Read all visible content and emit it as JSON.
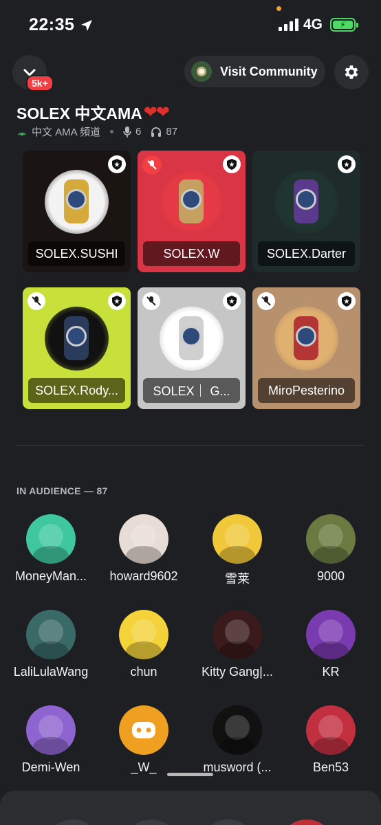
{
  "status": {
    "time": "22:35",
    "network": "4G"
  },
  "header": {
    "badge": "5k+",
    "visit_label": "Visit Community"
  },
  "stage": {
    "title": "SOLEX 中文AMA",
    "channel": "中文 AMA 頻道",
    "speakers_count": "6",
    "listeners_count": "87"
  },
  "speakers": [
    {
      "name": "SOLEX.SUSHI",
      "bg": "#1a1413",
      "art": "#f3f3f3",
      "watch": "#d6aa3a",
      "muted": false
    },
    {
      "name": "SOLEX.W",
      "bg": "#d93545",
      "art": "#e53a45",
      "watch": "#c5a060",
      "muted": true
    },
    {
      "name": "SOLEX.Darter",
      "bg": "#1f2a2a",
      "art": "#203530",
      "watch": "#5b3a8e",
      "muted": false
    },
    {
      "name": "SOLEX.Rody...",
      "bg": "#c8e03a",
      "art": "#111111",
      "watch": "#2b3b5c",
      "muted": true
    },
    {
      "name": "SOLEX｜ G...",
      "bg": "#c6c6c6",
      "art": "#ffffff",
      "watch": "#d0d0d0",
      "muted": true
    },
    {
      "name": "MiroPesterino",
      "bg": "#b7906e",
      "art": "#e0b070",
      "watch": "#b33535",
      "muted": true
    }
  ],
  "audience": {
    "heading": "IN AUDIENCE — 87",
    "members": [
      {
        "name": "MoneyMan...",
        "color": "#3fc8a0"
      },
      {
        "name": "howard9602",
        "color": "#e8ddd6"
      },
      {
        "name": "雪莱",
        "color": "#f0c83a"
      },
      {
        "name": "9000",
        "color": "#6a7a40"
      },
      {
        "name": "LaliLulaWang",
        "color": "#3a6a68"
      },
      {
        "name": "chun",
        "color": "#f4d23a"
      },
      {
        "name": "Kitty Gang|...",
        "color": "#3a1a1a"
      },
      {
        "name": "KR",
        "color": "#7a3ab0"
      },
      {
        "name": "Demi-Wen",
        "color": "#8e64d0"
      },
      {
        "name": "_W_",
        "color": "#f0a020"
      },
      {
        "name": "musword (...",
        "color": "#111111"
      },
      {
        "name": "Ben53",
        "color": "#c23040"
      }
    ]
  }
}
